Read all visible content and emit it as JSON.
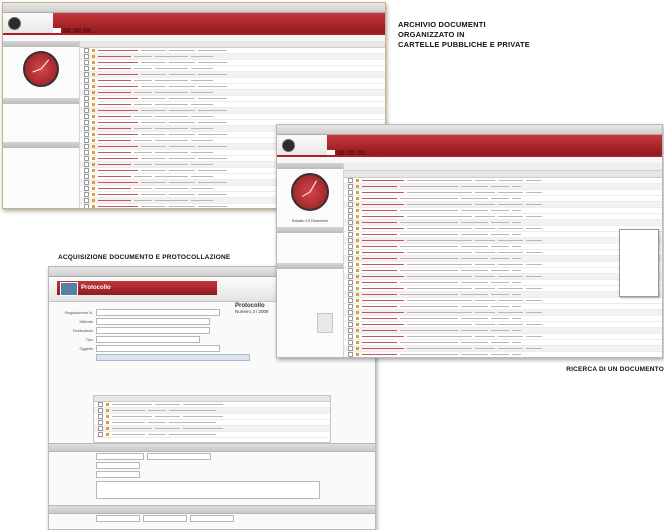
{
  "captions": {
    "archive": [
      "ARCHIVIO DOCUMENTI",
      "ORGANIZZATO IN",
      "CARTELLE PUBBLICHE E PRIVATE"
    ],
    "acquisition": "ACQUISIZIONE DOCUMENTO E PROTOCOLLAZIONE",
    "search": "RICERCA DI UN DOCUMENTO"
  },
  "colors": {
    "accent": "#b01f24",
    "accent_dark": "#8f1a1e",
    "title_bg": "#e0e0e0"
  },
  "icons": {
    "clock": "clock-icon",
    "folder": "folder-icon",
    "document": "document-icon"
  },
  "clock_label": "Sabato 19 Dicembre",
  "form": {
    "title": "Protocollo",
    "protocol_number": "Numero 3 / 2008",
    "fields": [
      {
        "label": "Registrazione N.",
        "value": ""
      },
      {
        "label": "Mittente",
        "value": ""
      },
      {
        "label": "Destinatario",
        "value": ""
      },
      {
        "label": "Tipo",
        "value": ""
      },
      {
        "label": "Oggetto",
        "value": ""
      }
    ]
  }
}
